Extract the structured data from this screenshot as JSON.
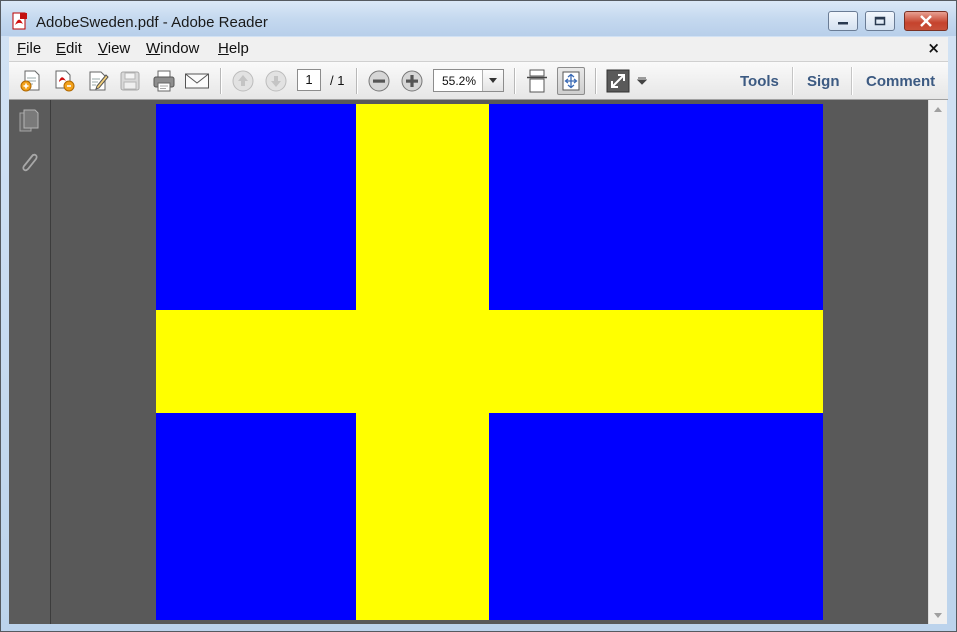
{
  "window": {
    "title": "AdobeSweden.pdf - Adobe Reader"
  },
  "menubar": {
    "items": [
      {
        "label": "File",
        "u": "F",
        "rest": "ile"
      },
      {
        "label": "Edit",
        "u": "E",
        "rest": "dit"
      },
      {
        "label": "View",
        "u": "V",
        "rest": "iew"
      },
      {
        "label": "Window",
        "u": "W",
        "rest": "indow"
      },
      {
        "label": "Help",
        "u": "H",
        "rest": "elp"
      }
    ],
    "close_glyph": "×"
  },
  "toolbar": {
    "page_current": "1",
    "page_total": "/ 1",
    "zoom": "55.2%",
    "icons": [
      "create-pdf-icon",
      "share-pdf-icon",
      "edit-pdf-icon",
      "save-icon",
      "print-icon",
      "email-icon",
      "previous-page-icon",
      "next-page-icon",
      "zoom-out-icon",
      "zoom-in-icon",
      "scrolling-mode-icon",
      "fit-page-icon",
      "full-screen-icon",
      "customize-toolbar-icon"
    ]
  },
  "task_panes": {
    "tools": "Tools",
    "sign": "Sign",
    "comment": "Comment"
  },
  "navpane": {
    "icons": [
      "page-thumbnails-icon",
      "attachments-icon"
    ]
  },
  "document": {
    "flag_colors": {
      "blue": "#0000ff",
      "yellow": "#ffff00"
    }
  }
}
